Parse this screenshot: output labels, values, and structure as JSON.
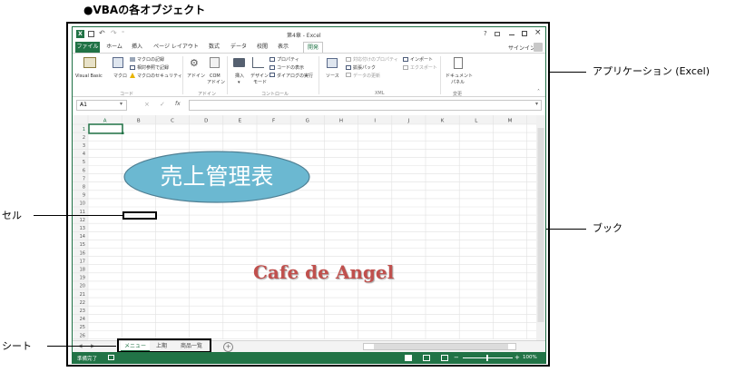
{
  "figure_title": "●VBAの各オブジェクト",
  "callouts": {
    "application": "アプリケーション (Excel)",
    "book": "ブック",
    "cell": "セル",
    "sheet": "シート"
  },
  "excel": {
    "window_title": "第4章 - Excel",
    "help": "?",
    "signin": "サインイン",
    "tabs": [
      "ファイル",
      "ホーム",
      "挿入",
      "ページ レイアウト",
      "数式",
      "データ",
      "校閲",
      "表示",
      "開発"
    ],
    "ribbon": {
      "visual_basic": "Visual Basic",
      "macro": "マクロ",
      "record_macro": "マクロの記録",
      "relative_ref": "相対参照で記録",
      "macro_security": "マクロのセキュリティ",
      "group_code": "コード",
      "addin": "アドイン",
      "com_addin_1": "COM",
      "com_addin_2": "アドイン",
      "group_addin": "アドイン",
      "insert": "挿入",
      "design_mode_1": "デザイン",
      "design_mode_2": "モード",
      "properties": "プロパティ",
      "view_code": "コードの表示",
      "run_dialog": "ダイアログの実行",
      "group_controls": "コントロール",
      "source": "ソース",
      "map_props": "対応付けのプロパティ",
      "expansion_pack": "拡張パック",
      "refresh_data": "データの更新",
      "import": "インポート",
      "export": "エクスポート",
      "group_xml": "XML",
      "doc_panel_1": "ドキュメント",
      "doc_panel_2": "パネル",
      "group_modify": "変更"
    },
    "name_box": "A1",
    "fx": "fx",
    "columns": [
      "A",
      "B",
      "C",
      "D",
      "E",
      "F",
      "G",
      "H",
      "I",
      "J",
      "K",
      "L",
      "M"
    ],
    "rows": [
      "1",
      "2",
      "3",
      "4",
      "5",
      "6",
      "7",
      "8",
      "9",
      "10",
      "11",
      "12",
      "13",
      "14",
      "15",
      "16",
      "17",
      "18",
      "19",
      "20",
      "21",
      "22",
      "23",
      "24",
      "25",
      "26"
    ],
    "shape_text": "売上管理表",
    "decor_text": "Cafe de Angel",
    "sheets": [
      "メニュー",
      "上期",
      "商品一覧"
    ],
    "add_sheet": "+",
    "status_ready": "準備完了",
    "zoom": "100%",
    "colors": {
      "excel_green": "#217346",
      "shape_fill": "#6bb8d1",
      "decor_text": "#c0504d"
    }
  }
}
